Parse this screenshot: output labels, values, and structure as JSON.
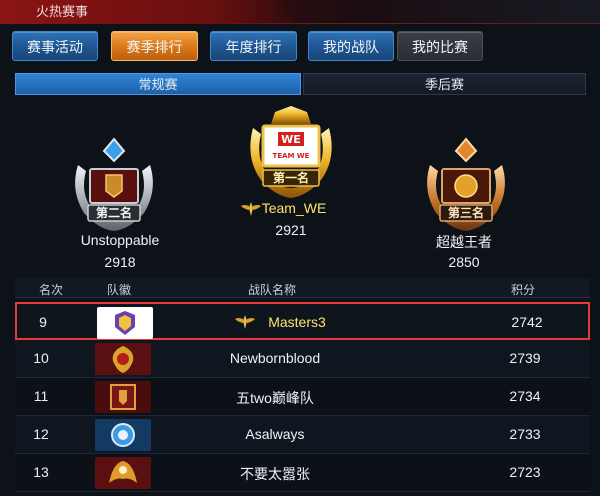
{
  "header": {
    "title": "火热赛事"
  },
  "nav": {
    "items": [
      {
        "label": "赛事活动"
      },
      {
        "label": "赛季排行",
        "active": true
      },
      {
        "label": "年度排行"
      },
      {
        "label": "我的战队"
      },
      {
        "label": "我的比赛"
      }
    ]
  },
  "subtabs": {
    "regular": "常规赛",
    "playoff": "季后赛"
  },
  "podium": {
    "first": {
      "name": "Team_WE",
      "score": "2921",
      "medal_text": "第一名",
      "logo_text": "WE",
      "logo_sub": "TEAM WE"
    },
    "second": {
      "name": "Unstoppable",
      "score": "2918",
      "medal_text": "第二名"
    },
    "third": {
      "name": "超越王者",
      "score": "2850",
      "medal_text": "第三名"
    }
  },
  "table": {
    "headers": {
      "rank": "名次",
      "badge": "队徽",
      "name": "战队名称",
      "score": "积分"
    },
    "rows": [
      {
        "rank": "9",
        "name": "Masters3",
        "score": "2742",
        "highlight": true
      },
      {
        "rank": "10",
        "name": "Newbornblood",
        "score": "2739"
      },
      {
        "rank": "11",
        "name": "五two巅峰队",
        "score": "2734"
      },
      {
        "rank": "12",
        "name": "Asalways",
        "score": "2733"
      },
      {
        "rank": "13",
        "name": "不要太嚣张",
        "score": "2723"
      }
    ]
  },
  "colors": {
    "accent_blue": "#2e73b9",
    "active_orange": "#e08425",
    "highlight_red": "#e53a35",
    "gold_text": "#ffe36a"
  }
}
